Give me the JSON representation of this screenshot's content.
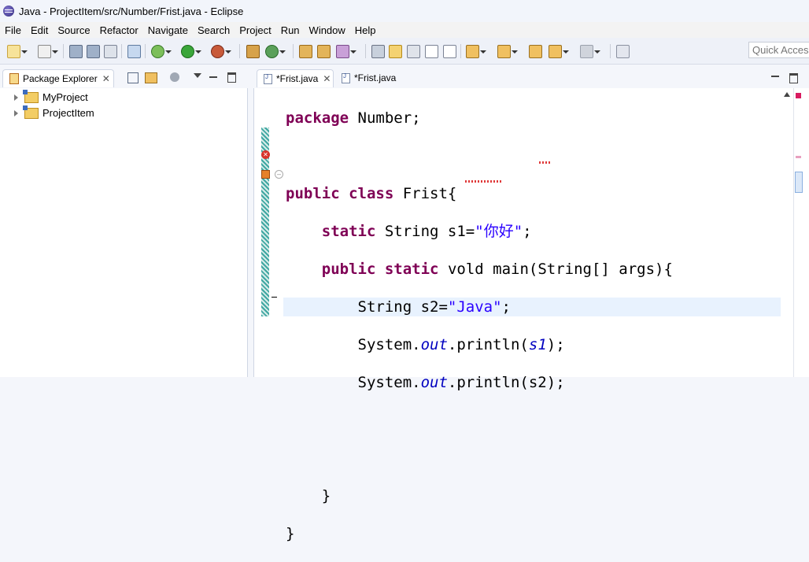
{
  "window": {
    "title": "Java - ProjectItem/src/Number/Frist.java - Eclipse"
  },
  "menu": [
    "File",
    "Edit",
    "Source",
    "Refactor",
    "Navigate",
    "Search",
    "Project",
    "Run",
    "Window",
    "Help"
  ],
  "toolbar": {
    "quick_access_placeholder": "Quick Access"
  },
  "package_explorer": {
    "tab_label": "Package Explorer",
    "projects": [
      "MyProject",
      "ProjectItem"
    ]
  },
  "editor": {
    "tabs": [
      "*Frist.java",
      "*Frist.java"
    ],
    "code": {
      "l1_kw": "package",
      "l1_rest": " Number;",
      "l3_kw1": "public",
      "l3_kw2": "class",
      "l3_rest": " Frist{",
      "l4_kw": "static",
      "l4_mid": " String s1=",
      "l4_str": "\"你好\"",
      "l4_end": ";",
      "l5_kw1": "public",
      "l5_kw2": "static",
      "l5_rest": " vold main(String[] args){",
      "l6_a": "String s2=",
      "l6_str": "\"Java\"",
      "l6_end": ";",
      "l7_a": "System.",
      "l7_field": "out",
      "l7_b": ".println(",
      "l7_arg": "s1",
      "l7_end": ");",
      "l8_a": "System.",
      "l8_field": "out",
      "l8_b": ".println(s2);",
      "l11": "}",
      "l12": "}"
    }
  },
  "colors": {
    "keyword": "#7f0055",
    "string": "#2a00ff",
    "field": "#0000c0",
    "error": "#d9342c"
  },
  "icons": {
    "error_marker": "error-icon",
    "warning_marker": "warning-icon"
  }
}
